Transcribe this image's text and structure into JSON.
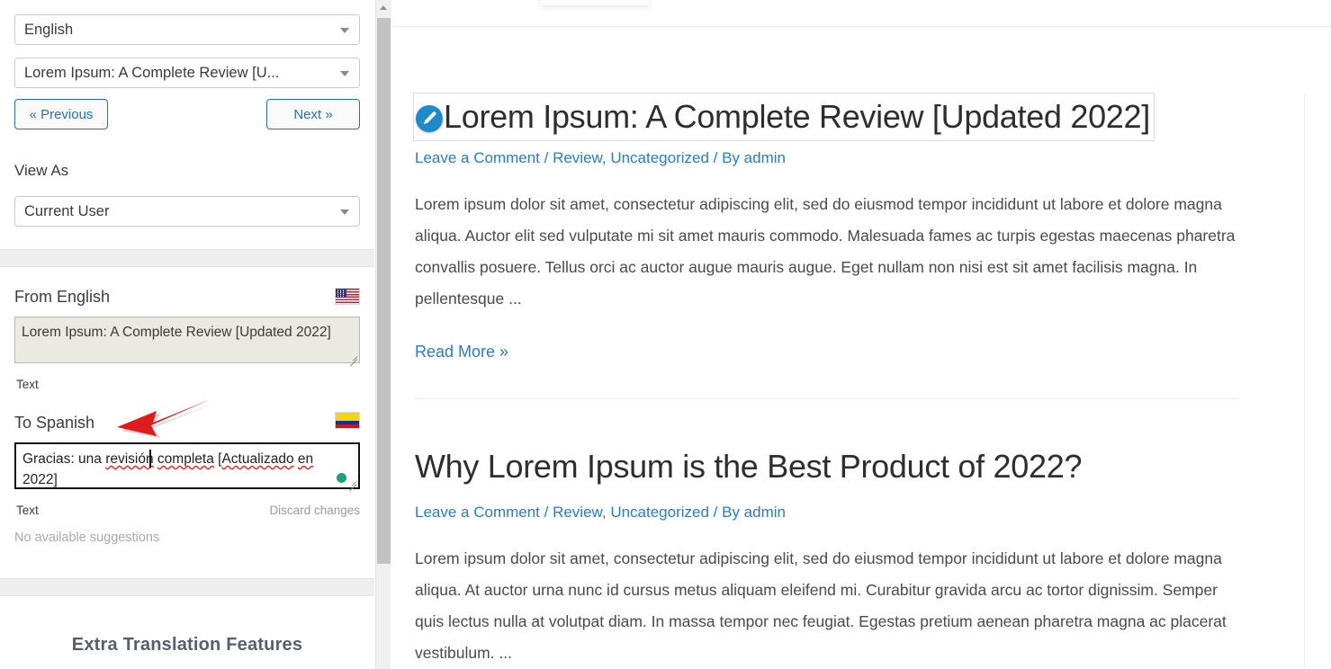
{
  "sidebar": {
    "language_select": {
      "value": "English",
      "icon": "chevron-down-icon"
    },
    "string_select": {
      "value": "Lorem Ipsum: A Complete Review [U...",
      "icon": "chevron-down-icon"
    },
    "prev_button": "« Previous",
    "next_button": "Next »",
    "view_as_label": "View As",
    "view_as_select": {
      "value": "Current User",
      "icon": "chevron-down-icon"
    },
    "from_block": {
      "title": "From English",
      "flag": "us-flag-icon",
      "value": "Lorem Ipsum: A Complete Review [Updated 2022]",
      "type_label": "Text"
    },
    "to_block": {
      "title": "To Spanish",
      "flag": "colombia-flag-icon",
      "value_part1": "Gracias: una ",
      "value_spell1": "revisión",
      "value_mid": " ",
      "value_spell2": "completa",
      "value_part2": " [",
      "value_spell3": "Actualizado",
      "value_part3": " ",
      "value_spell4": "en",
      "value_part4": "\n2022]",
      "full_value": "Gracias: una revisión completa [Actualizado en 2022]",
      "type_label": "Text",
      "discard_label": "Discard changes",
      "suggestions": "No available suggestions",
      "status_dot_color": "#1aa179"
    },
    "extra_features_heading": "Extra Translation Features"
  },
  "main": {
    "posts": [
      {
        "title": "Lorem Ipsum: A Complete Review [Updated 2022]",
        "edit_icon": "pencil-edit-icon",
        "meta": "Leave a Comment / Review, Uncategorized / By admin",
        "body": "Lorem ipsum dolor sit amet, consectetur adipiscing elit, sed do eiusmod tempor incididunt ut labore et dolore magna aliqua. Auctor elit sed vulputate mi sit amet mauris commodo. Malesuada fames ac turpis egestas maecenas pharetra convallis posuere. Tellus orci ac auctor augue mauris augue. Eget nullam non nisi est sit amet facilisis magna. In pellentesque ...",
        "read_more": "Read More »"
      },
      {
        "title": "Why Lorem Ipsum is the Best Product of 2022?",
        "meta": "Leave a Comment / Review, Uncategorized / By admin",
        "body": "Lorem ipsum dolor sit amet, consectetur adipiscing elit, sed do eiusmod tempor incididunt ut labore et dolore magna aliqua. At auctor urna nunc id cursus metus aliquam eleifend mi. Curabitur gravida arcu ac tortor dignissim. Semper quis lectus nulla at volutpat diam. In massa tempor nec feugiat. Egestas pretium aenean pharetra magna ac placerat vestibulum. ..."
      }
    ]
  },
  "annotation": {
    "arrow_color": "#e01b1b"
  },
  "colors": {
    "link_blue": "#2b7cc0",
    "button_blue": "#2171b5",
    "edit_badge_blue": "#1f8ac9",
    "source_textarea_bg": "#eaeae2"
  }
}
